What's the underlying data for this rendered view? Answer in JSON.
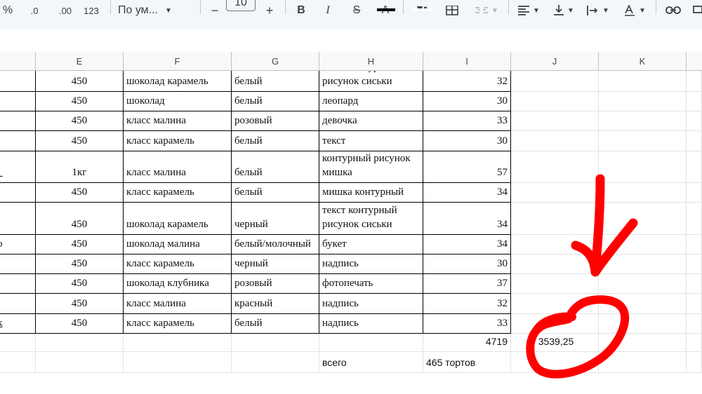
{
  "toolbar": {
    "percent": "%",
    "decrease_decimals": ".0",
    "increase_decimals": ".00",
    "format_123": "123",
    "font_name": "По ум...",
    "minus": "−",
    "font_size": "10",
    "plus": "+",
    "bold": "B",
    "italic": "I",
    "strikethrough": "S",
    "text_color": "A"
  },
  "columns": [
    "E",
    "F",
    "G",
    "H",
    "I",
    "J",
    "K"
  ],
  "row_fragments": [
    "_",
    "о",
    "k"
  ],
  "rows": [
    {
      "E": "450",
      "F": "шоколад карамель",
      "G": "белый",
      "H": "текст контурный\nрисунок сиськи",
      "I": "32"
    },
    {
      "E": "450",
      "F": "шоколад",
      "G": "белый",
      "H": "леопард",
      "I": "30"
    },
    {
      "E": "450",
      "F": "класс малина",
      "G": "розовый",
      "H": "девочка",
      "I": "33"
    },
    {
      "E": "450",
      "F": "класс карамель",
      "G": "белый",
      "H": "текст",
      "I": "30"
    },
    {
      "E": "1кг",
      "F": "класс малина",
      "G": "белый",
      "H": "контурный рисунок\nмишка",
      "I": "57"
    },
    {
      "E": "450",
      "F": "класс карамель",
      "G": "белый",
      "H": "мишка контурный",
      "I": "34"
    },
    {
      "E": "450",
      "F": "шоколад карамель",
      "G": "черный",
      "H": "текст контурный\nрисунок сиськи",
      "I": "34"
    },
    {
      "E": "450",
      "F": "шоколад малина",
      "G": "белый/молочный",
      "H": "букет",
      "I": "34"
    },
    {
      "E": "450",
      "F": "класс карамель",
      "G": "черный",
      "H": "надпись",
      "I": "30"
    },
    {
      "E": "450",
      "F": "шоколад клубника",
      "G": "розовый",
      "H": "фотопечать",
      "I": "37"
    },
    {
      "E": "450",
      "F": "класс малина",
      "G": "красный",
      "H": "надпись",
      "I": "32"
    },
    {
      "E": "450",
      "F": "класс карамель",
      "G": "белый",
      "H": "надпись",
      "I": "33"
    }
  ],
  "totals": {
    "I": "4719",
    "J": "3539,25"
  },
  "summary": {
    "H": "всего",
    "I": "465 тортов"
  },
  "annotation_color": "#ff0000"
}
